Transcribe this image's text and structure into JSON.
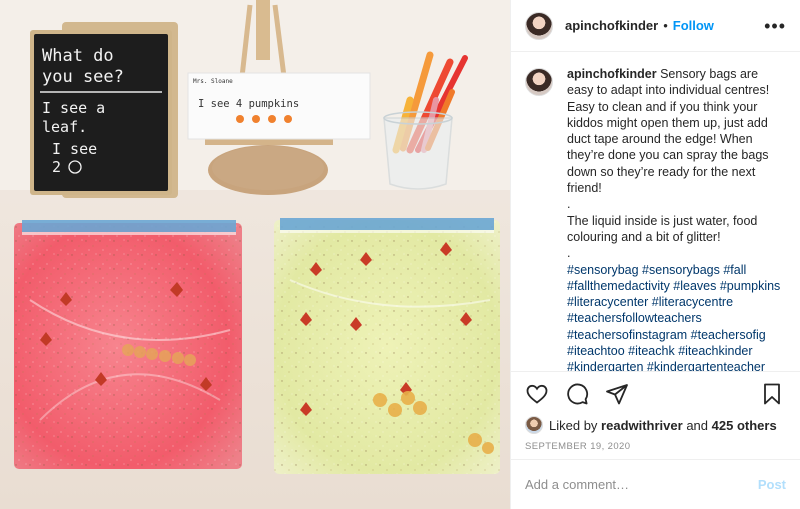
{
  "photo": {
    "chalkboard": {
      "line1": "What do",
      "line2": "you see?",
      "line3": "I see a",
      "line4": "leaf.",
      "line5": "I see",
      "line6": "2"
    },
    "card": {
      "name": "Mrs. Sloane",
      "sentence": "I see 4 pumpkins"
    }
  },
  "header": {
    "username": "apinchofkinder",
    "separator": "•",
    "follow_label": "Follow",
    "more_label": "•••"
  },
  "caption": {
    "username": "apinchofkinder",
    "text": "Sensory bags are easy to adapt into individual centres! Easy to clean and if you think your kiddos might open them up, just add duct tape around the edge! When they’re done you can spray the bags down so they’re ready for the next friend!",
    "dot1": ".",
    "text2": "The liquid inside is just water, food colouring and a bit of glitter!",
    "dot2": ".",
    "hashtags": "#sensorybag #sensorybags #fall #fallthemedactivity #leaves #pumpkins #literacycenter #literacycentre #teachersfollowteachers #teachersofinstagram #teachersofig #iteachtoo #iteachk #iteachkinder #kindergarten #kindergartenteacher #canadianteacher #ontarioteacher #fdk"
  },
  "actions": {
    "like_icon": "heart-icon",
    "comment_icon": "comment-bubble-icon",
    "share_icon": "paper-plane-icon",
    "save_icon": "bookmark-icon"
  },
  "likes": {
    "prefix": "Liked by",
    "user": "readwithriver",
    "and": "and",
    "others": "425 others"
  },
  "date": "SEPTEMBER 19, 2020",
  "comment": {
    "placeholder": "Add a comment…",
    "post_label": "Post"
  },
  "colors": {
    "follow": "#0095f6",
    "post_disabled": "#b2dffc",
    "hashtag": "#00376b",
    "red_bag": "#f46a78",
    "yellow_bag": "#e6ecaa"
  }
}
